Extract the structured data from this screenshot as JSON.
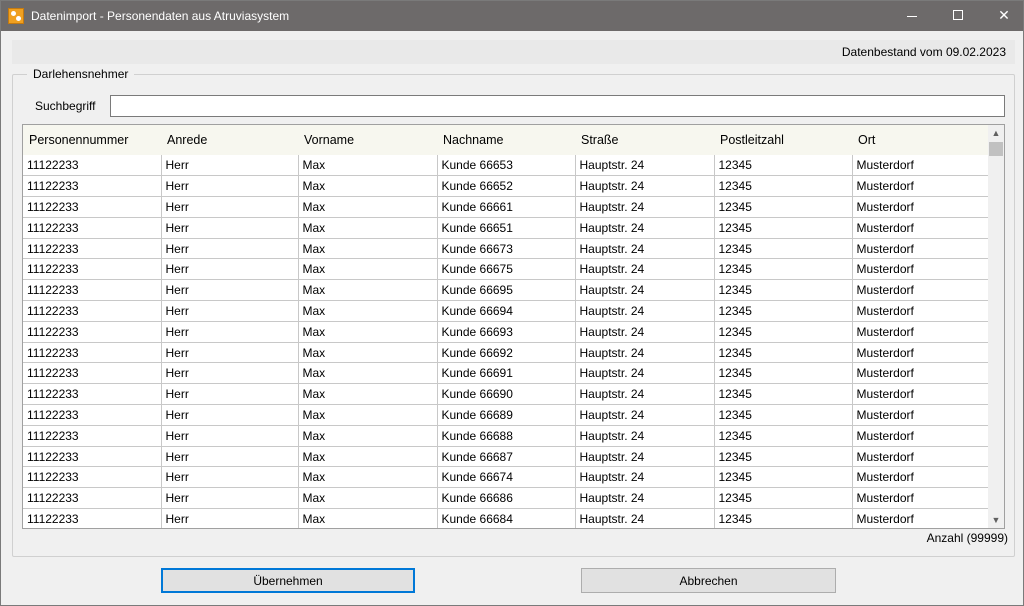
{
  "window": {
    "title": "Datenimport - Personendaten aus Atruviasystem",
    "controls": {
      "minimize": "minimize-icon",
      "maximize": "maximize-icon",
      "close": "close-icon"
    }
  },
  "header": {
    "datenbestand": "Datenbestand vom 09.02.2023"
  },
  "group": {
    "legend": "Darlehensnehmer"
  },
  "search": {
    "label": "Suchbegriff",
    "value": "",
    "placeholder": ""
  },
  "table": {
    "columns": [
      "Personennummer",
      "Anrede",
      "Vorname",
      "Nachname",
      "Straße",
      "Postleitzahl",
      "Ort"
    ],
    "rows": [
      [
        "11122233",
        "Herr",
        "Max",
        "Kunde 66653",
        "Hauptstr. 24",
        "12345",
        "Musterdorf"
      ],
      [
        "11122233",
        "Herr",
        "Max",
        "Kunde 66652",
        "Hauptstr. 24",
        "12345",
        "Musterdorf"
      ],
      [
        "11122233",
        "Herr",
        "Max",
        "Kunde 66661",
        "Hauptstr. 24",
        "12345",
        "Musterdorf"
      ],
      [
        "11122233",
        "Herr",
        "Max",
        "Kunde 66651",
        "Hauptstr. 24",
        "12345",
        "Musterdorf"
      ],
      [
        "11122233",
        "Herr",
        "Max",
        "Kunde 66673",
        "Hauptstr. 24",
        "12345",
        "Musterdorf"
      ],
      [
        "11122233",
        "Herr",
        "Max",
        "Kunde 66675",
        "Hauptstr. 24",
        "12345",
        "Musterdorf"
      ],
      [
        "11122233",
        "Herr",
        "Max",
        "Kunde 66695",
        "Hauptstr. 24",
        "12345",
        "Musterdorf"
      ],
      [
        "11122233",
        "Herr",
        "Max",
        "Kunde 66694",
        "Hauptstr. 24",
        "12345",
        "Musterdorf"
      ],
      [
        "11122233",
        "Herr",
        "Max",
        "Kunde 66693",
        "Hauptstr. 24",
        "12345",
        "Musterdorf"
      ],
      [
        "11122233",
        "Herr",
        "Max",
        "Kunde 66692",
        "Hauptstr. 24",
        "12345",
        "Musterdorf"
      ],
      [
        "11122233",
        "Herr",
        "Max",
        "Kunde 66691",
        "Hauptstr. 24",
        "12345",
        "Musterdorf"
      ],
      [
        "11122233",
        "Herr",
        "Max",
        "Kunde 66690",
        "Hauptstr. 24",
        "12345",
        "Musterdorf"
      ],
      [
        "11122233",
        "Herr",
        "Max",
        "Kunde 66689",
        "Hauptstr. 24",
        "12345",
        "Musterdorf"
      ],
      [
        "11122233",
        "Herr",
        "Max",
        "Kunde 66688",
        "Hauptstr. 24",
        "12345",
        "Musterdorf"
      ],
      [
        "11122233",
        "Herr",
        "Max",
        "Kunde 66687",
        "Hauptstr. 24",
        "12345",
        "Musterdorf"
      ],
      [
        "11122233",
        "Herr",
        "Max",
        "Kunde 66674",
        "Hauptstr. 24",
        "12345",
        "Musterdorf"
      ],
      [
        "11122233",
        "Herr",
        "Max",
        "Kunde 66686",
        "Hauptstr. 24",
        "12345",
        "Musterdorf"
      ],
      [
        "11122233",
        "Herr",
        "Max",
        "Kunde 66684",
        "Hauptstr. 24",
        "12345",
        "Musterdorf"
      ]
    ]
  },
  "footer": {
    "anzahl": "Anzahl (99999)"
  },
  "buttons": {
    "ok": "Übernehmen",
    "cancel": "Abbrechen"
  },
  "colors": {
    "titlebar": "#6d6a6a",
    "accent": "#0078d7",
    "header_row": "#f7f7ef"
  }
}
